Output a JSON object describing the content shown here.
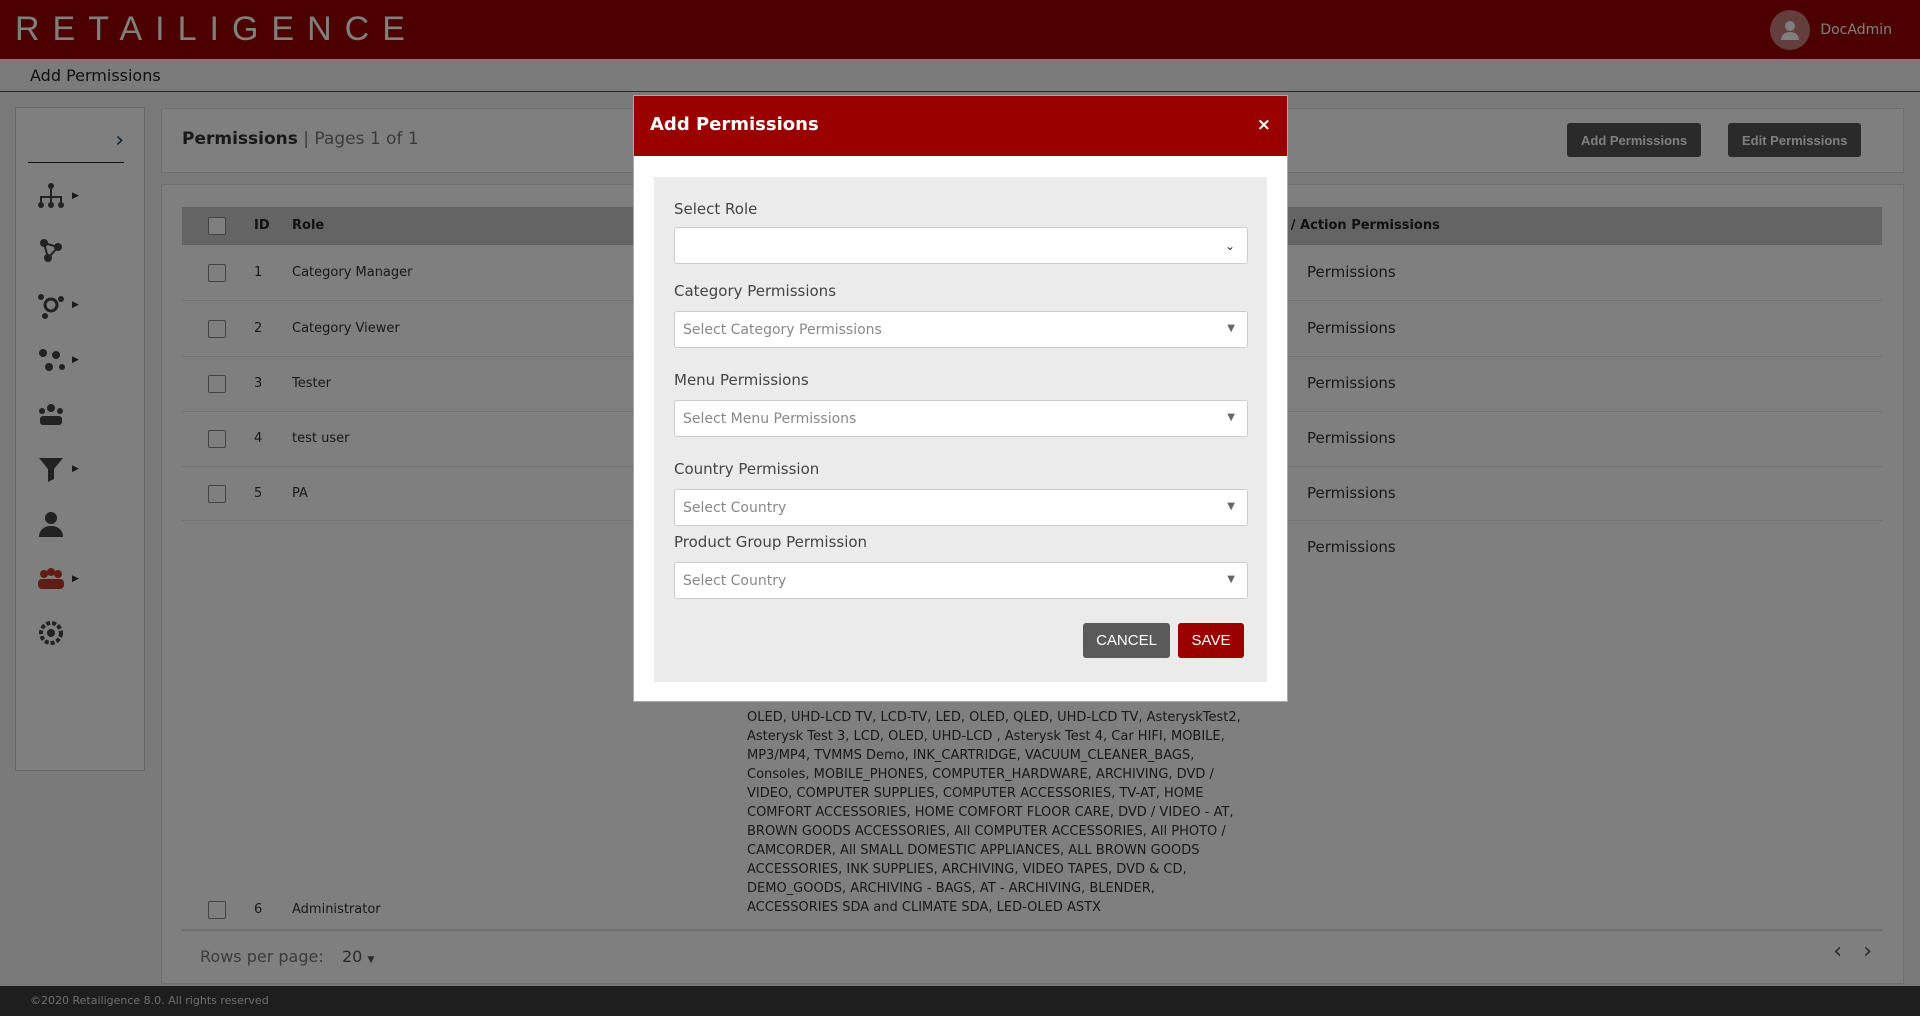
{
  "app": {
    "logo": "RETAILIGENCE",
    "username": "DocAdmin"
  },
  "subheader": {
    "title": "Add Permissions"
  },
  "panel": {
    "title": "Permissions",
    "pages": " | Pages 1 of 1",
    "add_button": "Add Permissions",
    "edit_button": "Edit Permissions"
  },
  "table": {
    "headers": {
      "id": "ID",
      "role": "Role",
      "menu_actions": "u / Action Permissions"
    },
    "rows": [
      {
        "id": "1",
        "role": "Category Manager",
        "perm": "Permissions"
      },
      {
        "id": "2",
        "role": "Category Viewer",
        "perm": "Permissions"
      },
      {
        "id": "3",
        "role": "Tester",
        "perm": "Permissions"
      },
      {
        "id": "4",
        "role": "test user",
        "perm": "Permissions"
      },
      {
        "id": "5",
        "role": "PA",
        "perm": "Permissions"
      },
      {
        "id": "6",
        "role": "Administrator",
        "perm": "Permissions"
      }
    ],
    "admin_categories": "OLED, UHD-LCD TV, LCD-TV, LED, OLED, QLED, UHD-LCD TV, AsteryskTest2, Asterysk Test 3, LCD, OLED, UHD-LCD , Asterysk Test 4, Car HIFI, MOBILE, MP3/MP4, TVMMS Demo, INK_CARTRIDGE, VACUUM_CLEANER_BAGS, Consoles, MOBILE_PHONES, COMPUTER_HARDWARE, ARCHIVING, DVD / VIDEO, COMPUTER SUPPLIES, COMPUTER ACCESSORIES, TV-AT, HOME COMFORT ACCESSORIES, HOME COMFORT FLOOR CARE, DVD / VIDEO - AT, BROWN GOODS ACCESSORIES, All COMPUTER ACCESSORIES, All PHOTO / CAMCORDER, All SMALL DOMESTIC APPLIANCES, ALL BROWN GOODS ACCESSORIES, INK SUPPLIES, ARCHIVING, VIDEO TAPES, DVD & CD, DEMO_GOODS, ARCHIVING - BAGS, AT - ARCHIVING, BLENDER, ACCESSORIES SDA and CLIMATE SDA, LED-OLED ASTX",
    "rows_per_page_label": "Rows per page:",
    "rows_per_page_value": "20"
  },
  "footer": {
    "copyright": "©2020 Retailigence 8.0. All rights reserved"
  },
  "modal": {
    "title": "Add Permissions",
    "close": "×",
    "fields": {
      "role_label": "Select Role",
      "category_label": "Category Permissions",
      "category_placeholder": "Select Category Permissions",
      "menu_label": "Menu Permissions",
      "menu_placeholder": "Select Menu Permissions",
      "country_label": "Country Permission",
      "country_placeholder": "Select Country",
      "product_label": "Product Group Permission",
      "product_placeholder": "Select Country"
    },
    "cancel": "CANCEL",
    "save": "SAVE"
  },
  "colors": {
    "brand": "#9a0000",
    "dark_button": "#555555"
  }
}
